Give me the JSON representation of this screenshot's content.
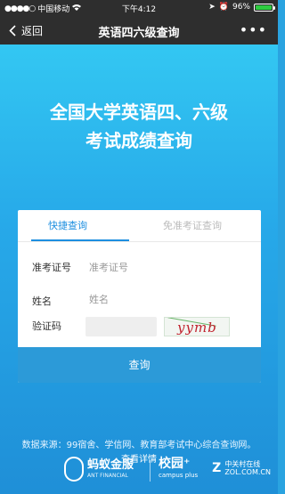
{
  "status": {
    "carrier": "中国移动",
    "time": "下午4:12",
    "battery_pct": "96%",
    "icons": [
      "signal-dots-icon",
      "wifi-icon",
      "location-icon",
      "alarm-icon",
      "battery-icon"
    ]
  },
  "nav": {
    "back_label": "返回",
    "title": "英语四六级查询",
    "more_label": "•••"
  },
  "hero": {
    "line1": "全国大学英语四、六级",
    "line2": "考试成绩查询"
  },
  "form": {
    "tabs": [
      {
        "label": "快捷查询",
        "active": true
      },
      {
        "label": "免准考证查询",
        "active": false
      }
    ],
    "fields": [
      {
        "label": "准考证号",
        "placeholder": "准考证号"
      },
      {
        "label": "姓名",
        "placeholder": "姓名"
      }
    ],
    "captcha": {
      "label": "验证码",
      "image_text": "yymb"
    },
    "submit_label": "查询"
  },
  "footer": {
    "source_text": "数据来源：99宿舍、学信网、教育部考试中心综合查询网。",
    "details_link": "查看详情"
  },
  "logos": {
    "ant_cn": "蚂蚁金服",
    "ant_en": "ANT FINANCIAL",
    "campus_cn": "校园⁺",
    "campus_en": "campus plus",
    "zol_mark": "Z",
    "zol_text_cn": "中关村在线",
    "zol_text_en": "ZOL.COM.CN"
  },
  "colors": {
    "accent": "#1d8fe0",
    "button": "#2c9ad8",
    "hero_top": "#33c7f2",
    "hero_bottom": "#1f8fd7"
  }
}
